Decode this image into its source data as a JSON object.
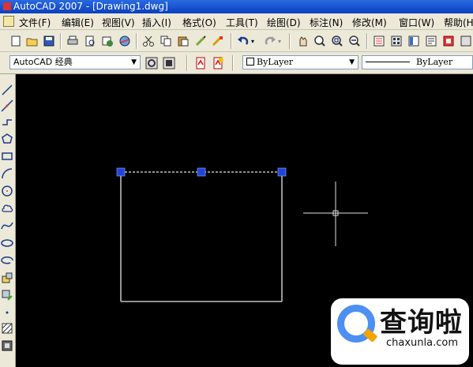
{
  "window": {
    "title": "AutoCAD 2007 - [Drawing1.dwg]"
  },
  "menubar": {
    "items": [
      {
        "label": "文件(F)"
      },
      {
        "label": "编辑(E)"
      },
      {
        "label": "视图(V)"
      },
      {
        "label": "插入(I)"
      },
      {
        "label": "格式(O)"
      },
      {
        "label": "工具(T)"
      },
      {
        "label": "绘图(D)"
      },
      {
        "label": "标注(N)"
      },
      {
        "label": "修改(M)"
      },
      {
        "label": "窗口(W)"
      },
      {
        "label": "帮助(H)"
      }
    ]
  },
  "toolbar": {
    "workspace": "AutoCAD 经典",
    "layer_color": "ByLayer",
    "linetype": "ByLayer",
    "icons": [
      "new-icon",
      "open-icon",
      "save-icon",
      "plot-icon",
      "plot-preview-icon",
      "publish-icon",
      "3d-dwf-icon",
      "cut-icon",
      "copy-icon",
      "paste-icon",
      "match-properties-icon",
      "block-editor-icon",
      "undo-icon",
      "redo-icon",
      "pan-icon",
      "zoom-realtime-icon",
      "zoom-window-icon",
      "zoom-previous-icon",
      "properties-icon",
      "design-center-icon",
      "tool-palettes-icon",
      "sheet-set-icon",
      "markup-icon"
    ]
  },
  "draw_toolbar": {
    "tools": [
      "line",
      "construction-line",
      "polyline",
      "polygon",
      "rectangle",
      "arc",
      "circle",
      "revision-cloud",
      "spline",
      "ellipse",
      "ellipse-arc",
      "insert-block",
      "make-block",
      "point",
      "hatch",
      "region"
    ]
  },
  "watermark": {
    "name": "查询啦",
    "url": "chaxunla.com"
  },
  "colors": {
    "canvas": "#000000",
    "grip": "#1f45d8",
    "title": "#0a3fc0",
    "logo_blue": "#4d8ff2",
    "logo_orange": "#f4a300"
  }
}
